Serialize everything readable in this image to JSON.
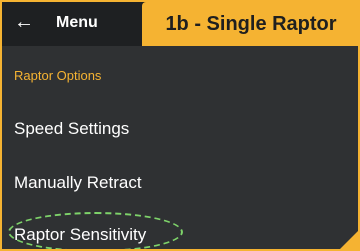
{
  "header": {
    "back_icon": "arrow-left-icon",
    "title": "Menu",
    "badge": "1b - Single Raptor"
  },
  "menu": {
    "section_header": "Raptor Options",
    "items": [
      {
        "label": "Speed Settings"
      },
      {
        "label": "Manually Retract"
      },
      {
        "label": "Raptor Sensitivity"
      }
    ]
  },
  "colors": {
    "accent": "#f5b332",
    "panel": "#2f3133",
    "topbar": "#1e2022",
    "highlight": "#7ed36a"
  }
}
